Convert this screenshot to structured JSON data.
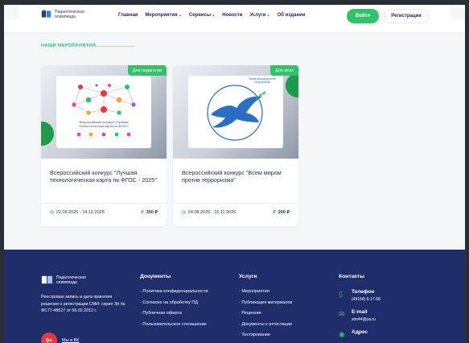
{
  "header": {
    "logo_text": "Педагогическая олимпиада",
    "nav": [
      {
        "label": "Главная",
        "dropdown": false
      },
      {
        "label": "Мероприятия",
        "dropdown": true
      },
      {
        "label": "Сервисы",
        "dropdown": true
      },
      {
        "label": "Новости",
        "dropdown": false
      },
      {
        "label": "Услуги",
        "dropdown": true
      },
      {
        "label": "Об издании",
        "dropdown": false
      }
    ],
    "login_label": "Войти",
    "register_label": "Регистрация"
  },
  "section": {
    "title": "НАШИ МЕРОПРИЯТИЯ"
  },
  "cards": [
    {
      "badge": "Для педагогов",
      "poster_caption": "Всероссийский конкурс «Лучшая технологическая карта по ФГОС»",
      "title": "Всероссийский конкурс \"Лучшая технологическая карта по ФГОС - 2025\"",
      "dates": "22.09.2025 - 14.12.2025",
      "price": "350 ₽"
    },
    {
      "badge": "Для всех",
      "poster_caption": "Всем миром против терроризма",
      "title": "Всероссийский конкурс \"Всем миром против терроризма\"",
      "dates": "24.08.2025 - 16.11.2025",
      "price": "200 ₽"
    }
  ],
  "footer": {
    "logo_text": "Педагогическая олимпиада",
    "registration": "Реестровая запись и дата принятия решения о регистрации СМИ: серия Эл № ФС77-48527 от 06.02.2012 г.",
    "vk_badge": "0+",
    "vk_label": "Мы в ВК",
    "documents": {
      "heading": "Документы",
      "items": [
        "Политика конфиденциальности",
        "Согласие на обработку ПД",
        "Публичная оферта",
        "Пользовательское соглашение"
      ]
    },
    "services": {
      "heading": "Услуги",
      "items": [
        "Мероприятия",
        "Публикация материалов",
        "Рецензия",
        "Документы к аттестации",
        "Тестирование"
      ]
    },
    "contacts": {
      "heading": "Контакты",
      "phone_label": "Телефон",
      "phone": "(49154) 5-17-58",
      "email_label": "E-mail",
      "email": "sdo44@ya.ru",
      "address_label": "Адрес"
    }
  },
  "colors": {
    "accent": "#2fc36a",
    "footer_bg": "#1f2d6b",
    "text": "#1f2b5b"
  }
}
